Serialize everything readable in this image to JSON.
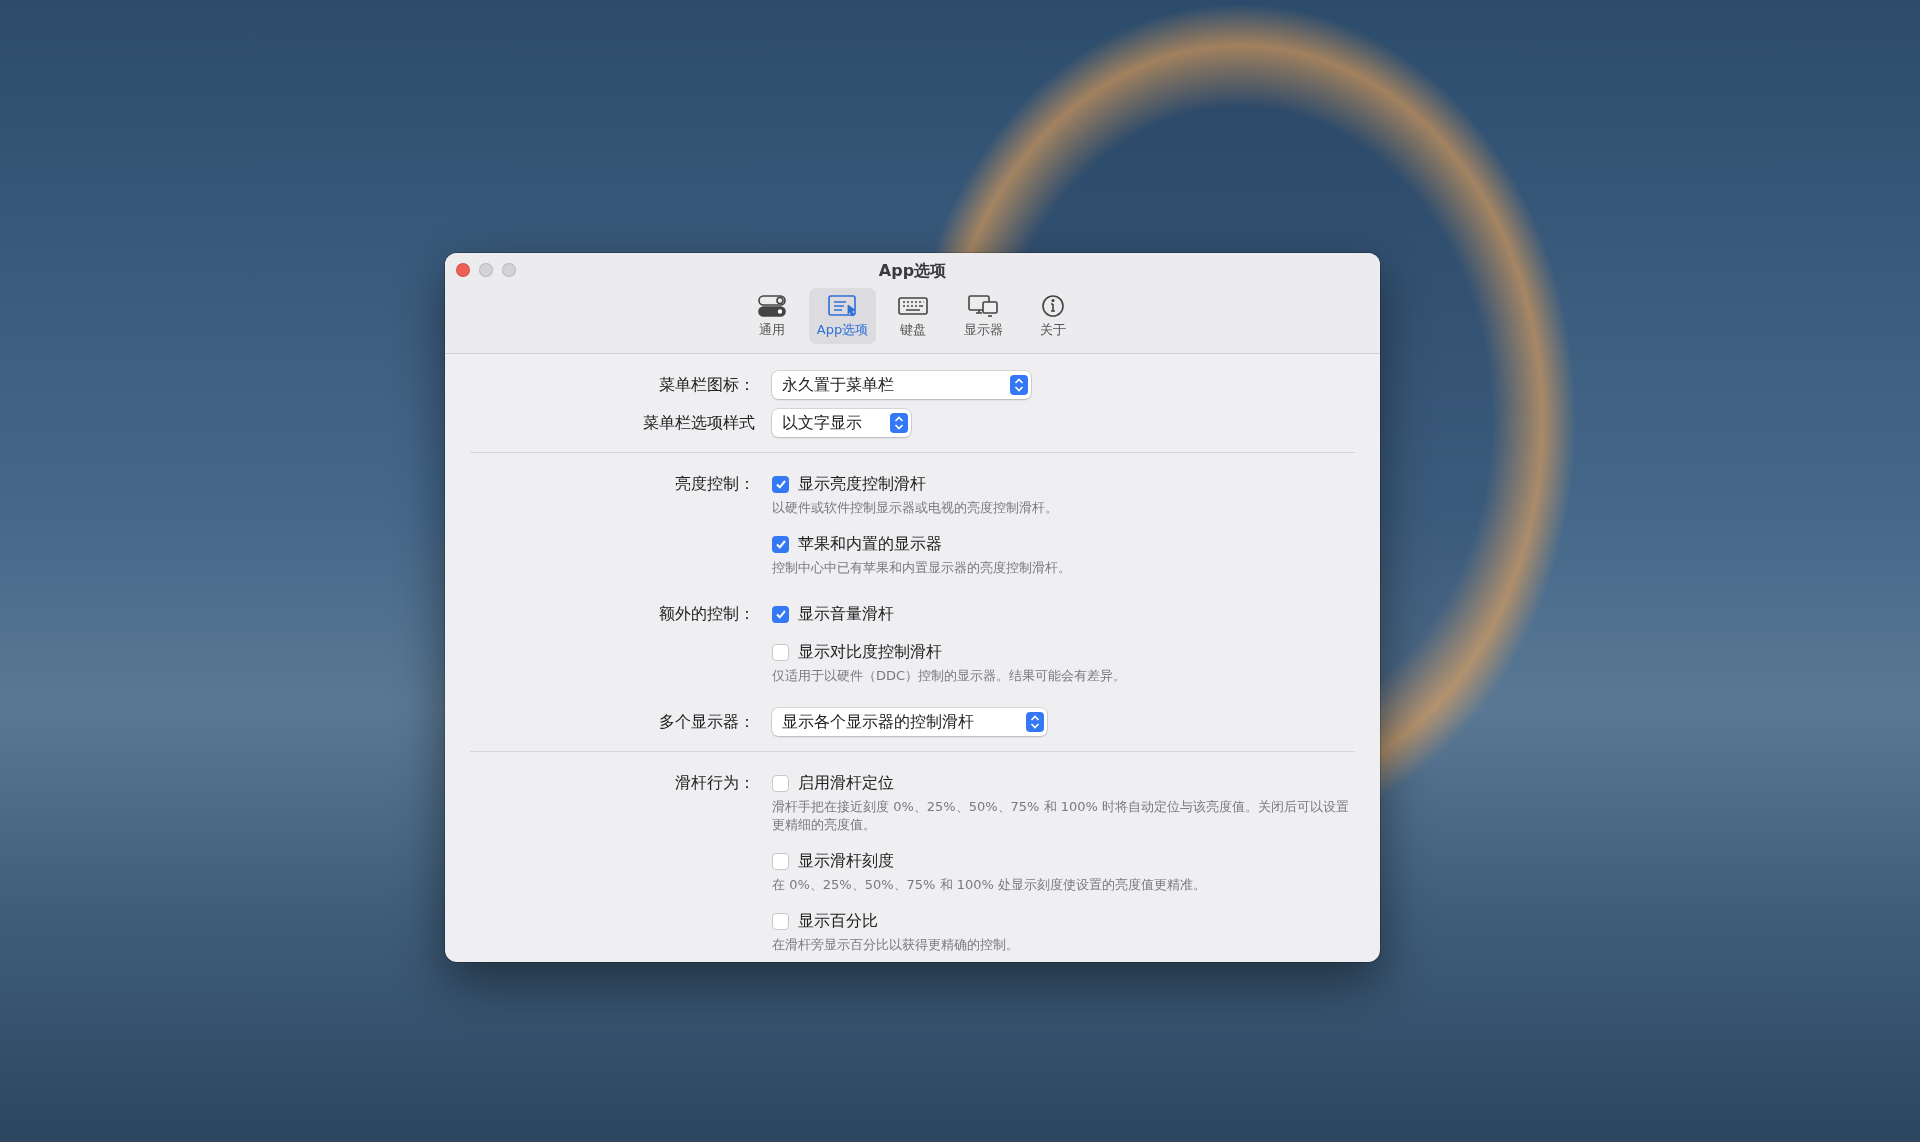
{
  "window": {
    "title": "App选项"
  },
  "tabs": [
    {
      "label": "通用",
      "kind": "toggles",
      "selected": false
    },
    {
      "label": "App选项",
      "kind": "app",
      "selected": true
    },
    {
      "label": "键盘",
      "kind": "keyboard",
      "selected": false
    },
    {
      "label": "显示器",
      "kind": "displays",
      "selected": false
    },
    {
      "label": "关于",
      "kind": "info",
      "selected": false
    }
  ],
  "sections": [
    {
      "rows": [
        {
          "kind": "select",
          "label": "菜单栏图标：",
          "value": "永久置于菜单栏"
        },
        {
          "kind": "select",
          "label": "菜单栏选项样式",
          "value": "以文字显示"
        }
      ]
    },
    {
      "rows": [
        {
          "kind": "checks",
          "label": "亮度控制：",
          "items": [
            {
              "label": "显示亮度控制滑杆",
              "checked": true,
              "description": "以硬件或软件控制显示器或电视的亮度控制滑杆。"
            },
            {
              "label": "苹果和内置的显示器",
              "checked": true,
              "description": "控制中心中已有苹果和内置显示器的亮度控制滑杆。"
            }
          ]
        },
        {
          "kind": "checks",
          "label": "额外的控制：",
          "items": [
            {
              "label": "显示音量滑杆",
              "checked": true
            },
            {
              "label": "显示对比度控制滑杆",
              "checked": false,
              "description": "仅适用于以硬件（DDC）控制的显示器。结果可能会有差异。"
            }
          ]
        },
        {
          "kind": "select",
          "label": "多个显示器：",
          "value": "显示各个显示器的控制滑杆"
        }
      ]
    },
    {
      "rows": [
        {
          "kind": "checks",
          "label": "滑杆行为：",
          "items": [
            {
              "label": "启用滑杆定位",
              "checked": false,
              "description": "滑杆手把在接近刻度 0%、25%、50%、75% 和 100% 时将自动定位与该亮度值。关闭后可以设置更精细的亮度值。"
            },
            {
              "label": "显示滑杆刻度",
              "checked": false,
              "description": "在 0%、25%、50%、75% 和 100% 处显示刻度使设置的亮度值更精准。"
            },
            {
              "label": "显示百分比",
              "checked": false,
              "description": "在滑杆旁显示百分比以获得更精确的控制。"
            }
          ]
        }
      ]
    }
  ]
}
